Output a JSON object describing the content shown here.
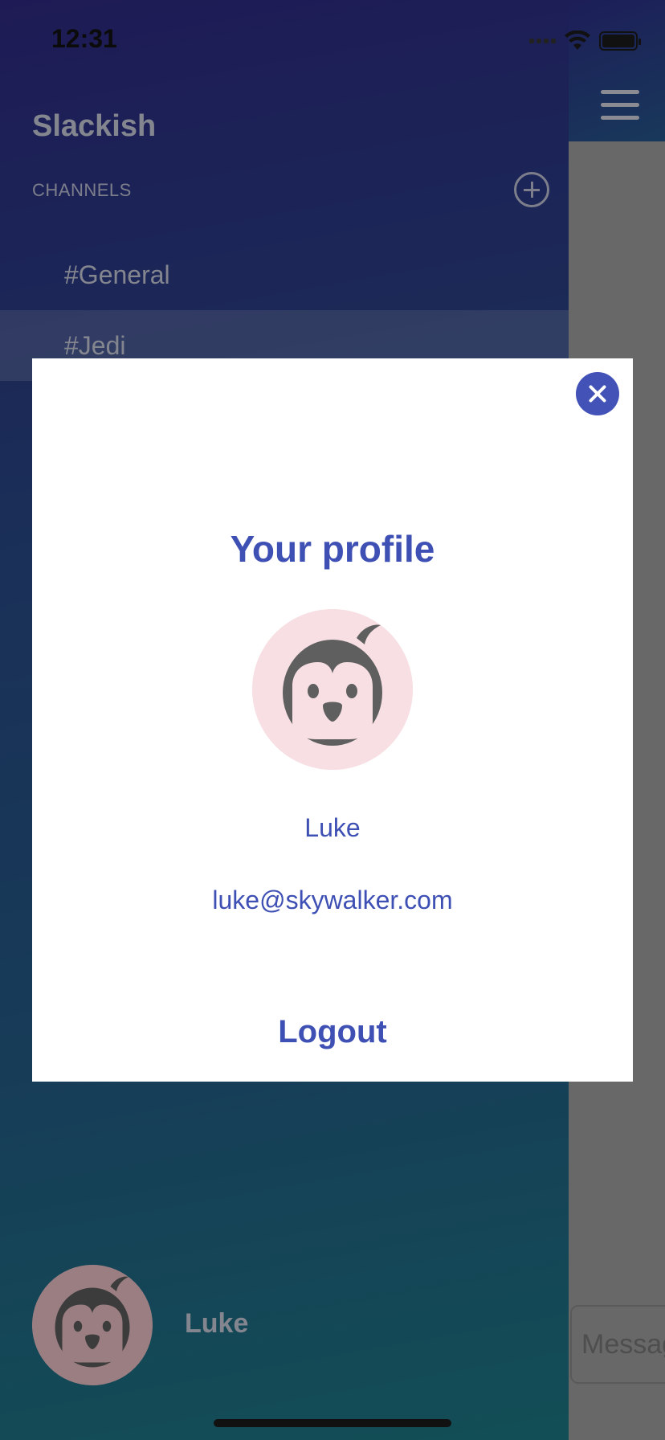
{
  "status_bar": {
    "time": "12:31"
  },
  "sidebar": {
    "app_title": "Slackish",
    "channels_label": "CHANNELS",
    "channels": [
      {
        "label": "#General",
        "selected": false
      },
      {
        "label": "#Jedi",
        "selected": true
      }
    ],
    "user_name": "Luke"
  },
  "main": {
    "message_placeholder": "Message"
  },
  "profile_modal": {
    "title": "Your profile",
    "name": "Luke",
    "email": "luke@skywalker.com",
    "logout_label": "Logout"
  },
  "icons": {
    "menu": "hamburger-icon",
    "add_channel": "plus-circle-icon",
    "close": "close-icon",
    "avatar": "penguin-avatar-icon"
  },
  "colors": {
    "accent": "#3f50b5",
    "close_button": "#4352b6",
    "avatar_bg": "#f7dfe3"
  }
}
